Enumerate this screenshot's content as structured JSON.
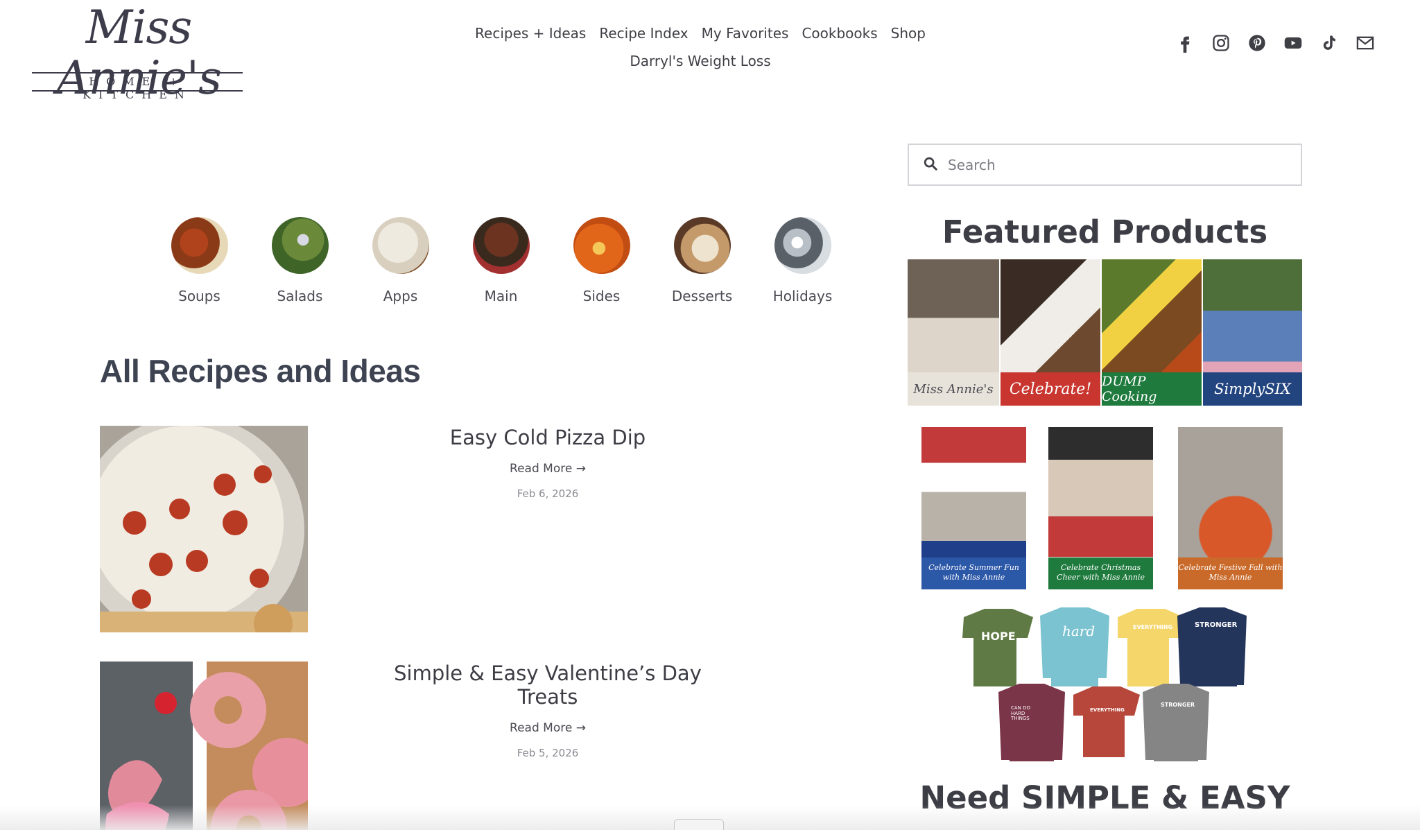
{
  "brand": {
    "logo_script": "Miss Annie's",
    "logo_sub": "HOME + KITCHEN"
  },
  "nav": {
    "items": [
      "Recipes + Ideas",
      "Recipe Index",
      "My Favorites",
      "Cookbooks",
      "Shop",
      "Darryl's Weight Loss"
    ]
  },
  "social": [
    "facebook-icon",
    "instagram-icon",
    "pinterest-icon",
    "youtube-icon",
    "tiktok-icon",
    "mail-icon"
  ],
  "categories": [
    "Soups",
    "Salads",
    "Apps",
    "Main",
    "Sides",
    "Desserts",
    "Holidays"
  ],
  "section_title": "All Recipes and Ideas",
  "posts": [
    {
      "title": "Easy Cold Pizza Dip",
      "read_more": "Read More →",
      "date": "Feb 6, 2026"
    },
    {
      "title": "Simple & Easy Valentine’s Day Treats",
      "read_more": "Read More →",
      "date": "Feb 5, 2026"
    }
  ],
  "sidebar": {
    "search_placeholder": "Search",
    "featured_title": "Featured Products",
    "cookbooks": [
      "Miss Annie's",
      "Celebrate!",
      "DUMP Cooking",
      "SimplySIX"
    ],
    "holiday_books": [
      "Celebrate Summer Fun with Miss Annie",
      "Celebrate Christmas Cheer with Miss Annie",
      "Celebrate Festive Fall with Miss Annie"
    ],
    "shirts": [
      "HOPE",
      "hard",
      "EVERYTHING",
      "STRONGER",
      "CAN DO HARD THINGS",
      "EVERYTHING",
      "STRONGER"
    ],
    "need_title": "Need SIMPLE & EASY"
  },
  "colors": {
    "text": "#3d3d45",
    "muted": "#8a8a92",
    "border": "#d4d4d8",
    "cookbook_red": "#c8362f",
    "cookbook_green": "#1f7a3e",
    "cookbook_blue": "#23457f",
    "book_orange": "#c96a2a"
  }
}
